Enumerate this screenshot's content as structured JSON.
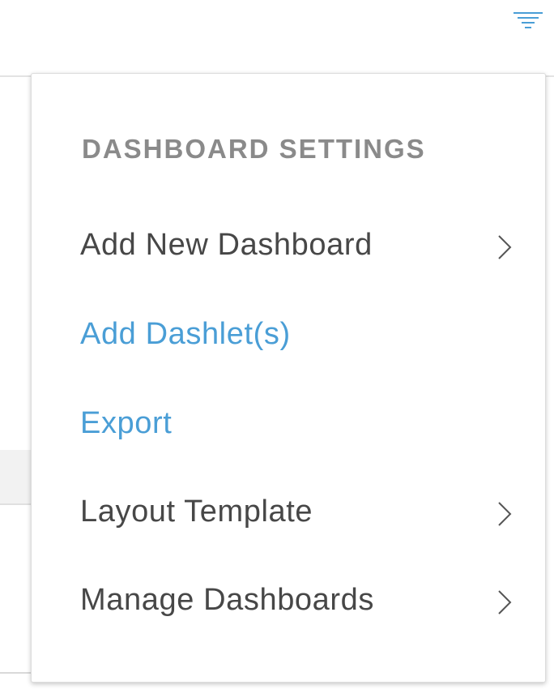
{
  "header": {
    "filter_icon": "filter-lines-icon",
    "accent": "#4a9ed6"
  },
  "menu": {
    "heading": "DASHBOARD SETTINGS",
    "items": [
      {
        "label": "Add New Dashboard",
        "has_submenu": true,
        "style": "default"
      },
      {
        "label": "Add Dashlet(s)",
        "has_submenu": false,
        "style": "link"
      },
      {
        "label": "Export",
        "has_submenu": false,
        "style": "link"
      },
      {
        "label": "Layout Template",
        "has_submenu": true,
        "style": "default"
      },
      {
        "label": "Manage Dashboards",
        "has_submenu": true,
        "style": "default"
      }
    ],
    "colors": {
      "heading": "#8a8a8a",
      "text": "#474747",
      "link": "#4a9ed6",
      "chevron": "#555555"
    }
  }
}
